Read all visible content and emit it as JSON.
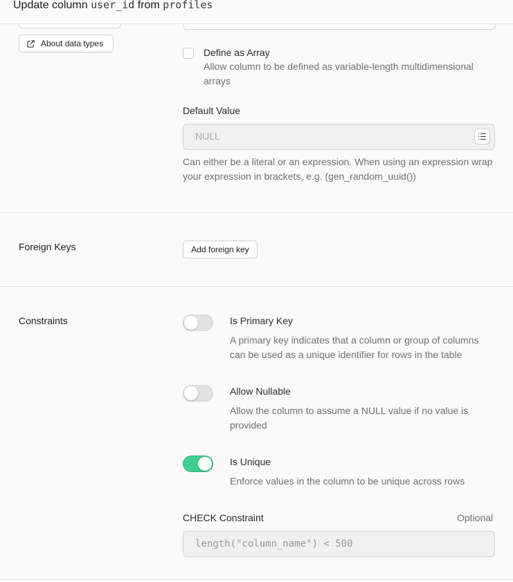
{
  "header": {
    "prefix": "Update column",
    "column": "user_id",
    "middle": "from",
    "table": "profiles"
  },
  "data_type": {
    "about_label": "About data types"
  },
  "array": {
    "label": "Define as Array",
    "description": "Allow column to be defined as variable-length multidimensional arrays",
    "checked": false
  },
  "default_value": {
    "label": "Default Value",
    "placeholder": "NULL",
    "hint": "Can either be a literal or an expression. When using an expression wrap your expression in brackets, e.g. (gen_random_uuid())"
  },
  "foreign_keys": {
    "title": "Foreign Keys",
    "add_label": "Add foreign key"
  },
  "constraints": {
    "title": "Constraints",
    "primary_key": {
      "label": "Is Primary Key",
      "description": "A primary key indicates that a column or group of columns can be used as a unique identifier for rows in the table",
      "on": false
    },
    "nullable": {
      "label": "Allow Nullable",
      "description": "Allow the column to assume a NULL value if no value is provided",
      "on": false
    },
    "unique": {
      "label": "Is Unique",
      "description": "Enforce values in the column to be unique across rows",
      "on": true
    },
    "check": {
      "label": "CHECK Constraint",
      "optional": "Optional",
      "placeholder": "length(\"column_name\") < 500"
    }
  },
  "colors": {
    "accent": "#3ecf8e",
    "border": "#e3e3e3",
    "muted_text": "#707070"
  },
  "icons": [
    "external-link-icon",
    "list-icon"
  ]
}
